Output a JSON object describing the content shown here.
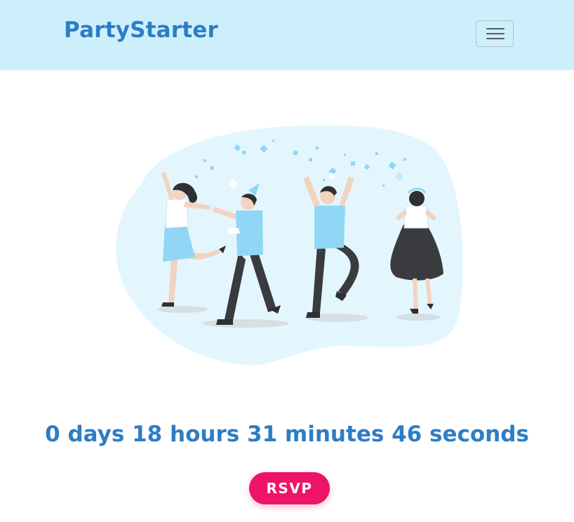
{
  "navbar": {
    "brand": "PartyStarter",
    "toggler_icon": "hamburger-menu-icon"
  },
  "hero": {
    "illustration": "dancing-people-confetti-illustration"
  },
  "countdown": {
    "days": 0,
    "hours": 18,
    "minutes": 31,
    "seconds": 46,
    "text": "0 days 18 hours 31 minutes 46 seconds"
  },
  "cta": {
    "rsvp_label": "RSVP"
  },
  "colors": {
    "navbar_bg": "#cdeffc",
    "brand": "#2e7dc4",
    "countdown": "#2e7dc4",
    "rsvp_bg": "#ee1467",
    "blob": "#e4f6fd",
    "accent_blue": "#6ccbef"
  }
}
